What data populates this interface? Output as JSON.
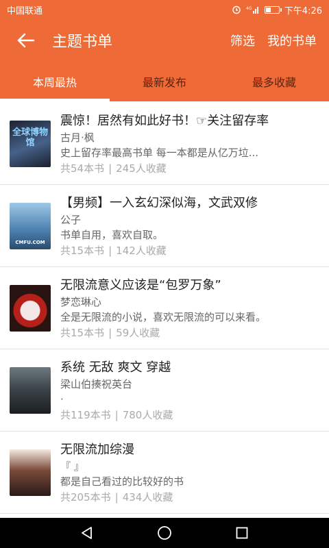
{
  "status_bar": {
    "carrier": "中国联通",
    "network": "4G",
    "time": "下午4:26",
    "battery_level": 0.35
  },
  "app_bar": {
    "title": "主题书单",
    "filter_label": "筛选",
    "my_lists_label": "我的书单",
    "back_icon": "arrow-left-icon"
  },
  "tabs": [
    {
      "label": "本周最热",
      "active": true
    },
    {
      "label": "最新发布",
      "active": false
    },
    {
      "label": "最多收藏",
      "active": false
    }
  ],
  "booklists": [
    {
      "title": "震惊！居然有如此好书！☞关注留存率",
      "author": "古月·枫",
      "description": "史上留存率最高书单   每一本都是从亿万垃...",
      "book_count": "共54本书",
      "favorites": "245人收藏",
      "cover_text": "全球博物馆",
      "cover_color": "#2b3a55"
    },
    {
      "title": "【男频】一入玄幻深似海，文武双修",
      "author": "公子",
      "description": "书单自用，喜欢自取。",
      "book_count": "共15本书",
      "favorites": "142人收藏",
      "cover_text": "CMFU.COM",
      "cover_color": "#4f86b8"
    },
    {
      "title": "无限流意义应该是“包罗万象”",
      "author": "梦恋琳心",
      "description": "全是无限流的小说，喜欢无限流的可以来看。",
      "book_count": "共15本书",
      "favorites": "59人收藏",
      "cover_text": "",
      "cover_color": "#c22a1f"
    },
    {
      "title": "系统  无敌  爽文  穿越",
      "author": "梁山伯揍祝英台",
      "description": "·",
      "book_count": "共119本书",
      "favorites": "780人收藏",
      "cover_text": "",
      "cover_color": "#3a4146"
    },
    {
      "title": "无限流加综漫",
      "author": "『 』",
      "description": "都是自己看过的比较好的书",
      "book_count": "共205本书",
      "favorites": "434人收藏",
      "cover_text": "",
      "cover_color": "#3b2a26"
    }
  ],
  "stats_separator": "|",
  "nav_bar": {
    "back": "triangle-back-icon",
    "home": "circle-home-icon",
    "recents": "square-recents-icon"
  }
}
